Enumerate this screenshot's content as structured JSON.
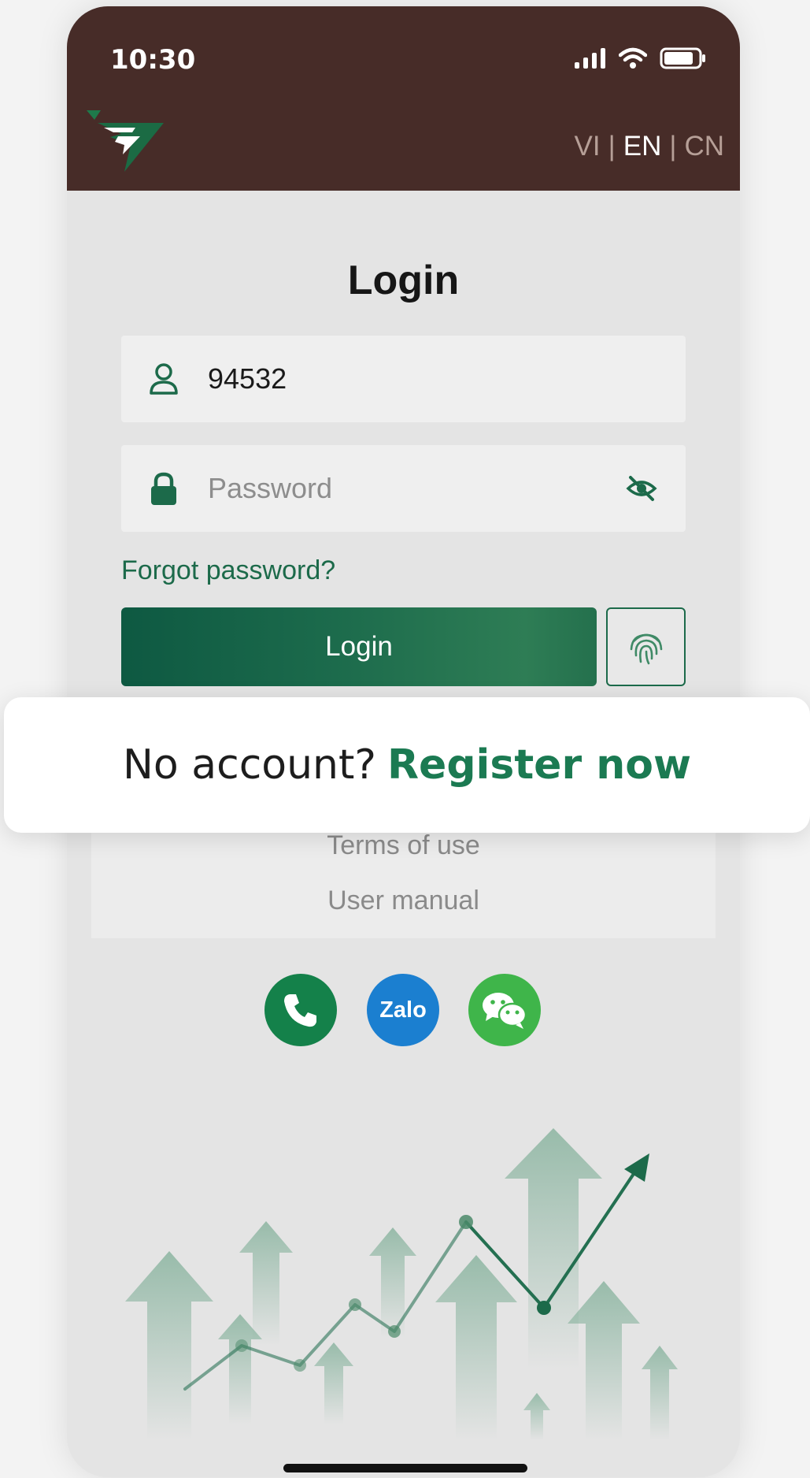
{
  "status_bar": {
    "time": "10:30"
  },
  "header": {
    "languages": [
      {
        "code": "VI",
        "active": false
      },
      {
        "code": "EN",
        "active": true
      },
      {
        "code": "CN",
        "active": false
      }
    ],
    "separator": "|"
  },
  "login_form": {
    "title": "Login",
    "username_value": "94532",
    "password_placeholder": "Password",
    "forgot_label": "Forgot password?",
    "login_label": "Login"
  },
  "register": {
    "question": "No account?",
    "action": "Register now"
  },
  "links": {
    "terms": "Terms of use",
    "manual": "User manual"
  },
  "social": {
    "zalo_label": "Zalo",
    "icons": [
      "phone-icon",
      "zalo-icon",
      "wechat-icon"
    ]
  },
  "colors": {
    "header_bg": "#472c28",
    "primary_green": "#1c6a4a",
    "zalo_blue": "#1b7fd0",
    "wechat_green": "#3fb54a"
  }
}
